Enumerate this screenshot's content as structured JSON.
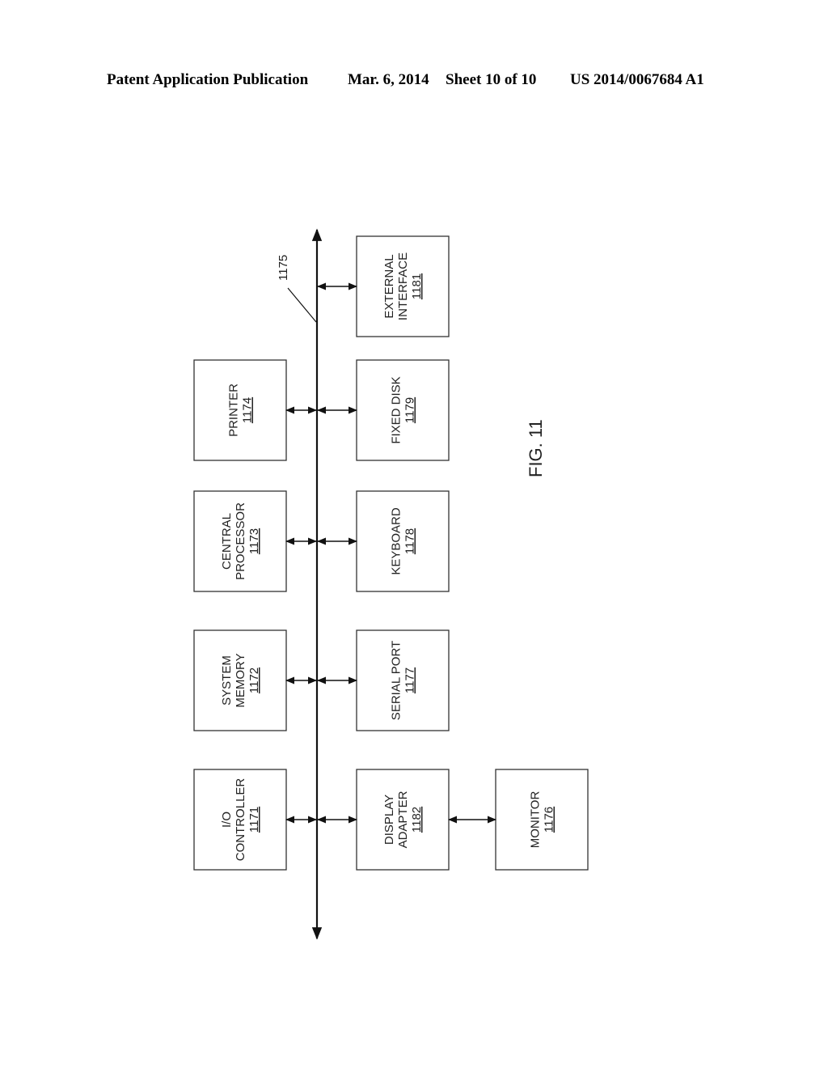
{
  "header": {
    "publication": "Patent Application Publication",
    "date": "Mar. 6, 2014",
    "sheet": "Sheet 10 of 10",
    "number": "US 2014/0067684 A1"
  },
  "figure": {
    "label": "FIG. 11",
    "bus_ref": "1175",
    "blocks": [
      {
        "id": "printer",
        "lines": [
          "PRINTER"
        ],
        "ref": "1174"
      },
      {
        "id": "central-processor",
        "lines": [
          "CENTRAL",
          "PROCESSOR"
        ],
        "ref": "1173"
      },
      {
        "id": "system-memory",
        "lines": [
          "SYSTEM",
          "MEMORY"
        ],
        "ref": "1172"
      },
      {
        "id": "io-controller",
        "lines": [
          "I/O",
          "CONTROLLER"
        ],
        "ref": "1171"
      },
      {
        "id": "external-interface",
        "lines": [
          "EXTERNAL",
          "INTERFACE"
        ],
        "ref": "1181"
      },
      {
        "id": "fixed-disk",
        "lines": [
          "FIXED DISK"
        ],
        "ref": "1179"
      },
      {
        "id": "keyboard",
        "lines": [
          "KEYBOARD"
        ],
        "ref": "1178"
      },
      {
        "id": "serial-port",
        "lines": [
          "SERIAL PORT"
        ],
        "ref": "1177"
      },
      {
        "id": "display-adapter",
        "lines": [
          "DISPLAY",
          "ADAPTER"
        ],
        "ref": "1182"
      },
      {
        "id": "monitor",
        "lines": [
          "MONITOR"
        ],
        "ref": "1176"
      }
    ],
    "connections": [
      {
        "from": "printer",
        "to": "bus"
      },
      {
        "from": "central-processor",
        "to": "bus"
      },
      {
        "from": "system-memory",
        "to": "bus"
      },
      {
        "from": "io-controller",
        "to": "bus"
      },
      {
        "from": "bus",
        "to": "external-interface"
      },
      {
        "from": "bus",
        "to": "fixed-disk"
      },
      {
        "from": "bus",
        "to": "keyboard"
      },
      {
        "from": "bus",
        "to": "serial-port"
      },
      {
        "from": "bus",
        "to": "display-adapter"
      },
      {
        "from": "display-adapter",
        "to": "monitor"
      }
    ]
  }
}
